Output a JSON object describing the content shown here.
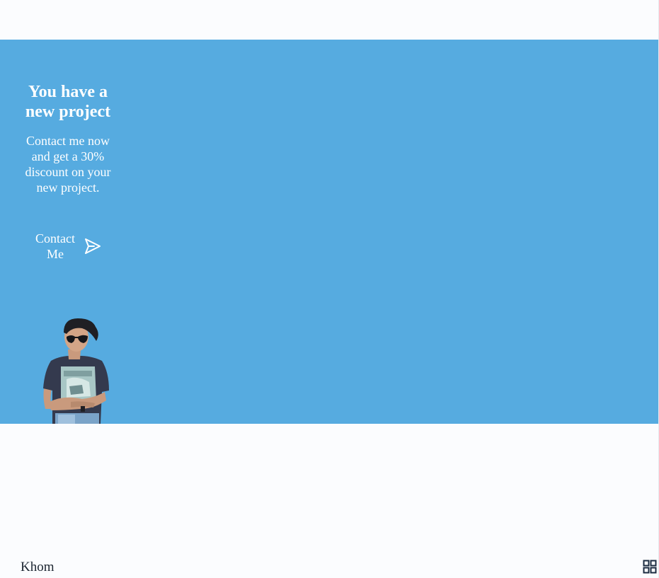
{
  "banner": {
    "title": "You have a new project",
    "description": "Contact me now and get a 30% discount on your new project.",
    "contact_button": {
      "label": "Contact Me",
      "icon": "send-icon"
    },
    "image": "person-photo",
    "background_color": "#56abe0"
  },
  "footer": {
    "brand": "Khom",
    "menu_icon": "grid-icon"
  },
  "colors": {
    "page_background": "#fbfcfe",
    "text_dark": "#1b2430",
    "text_light": "#ffffff"
  }
}
